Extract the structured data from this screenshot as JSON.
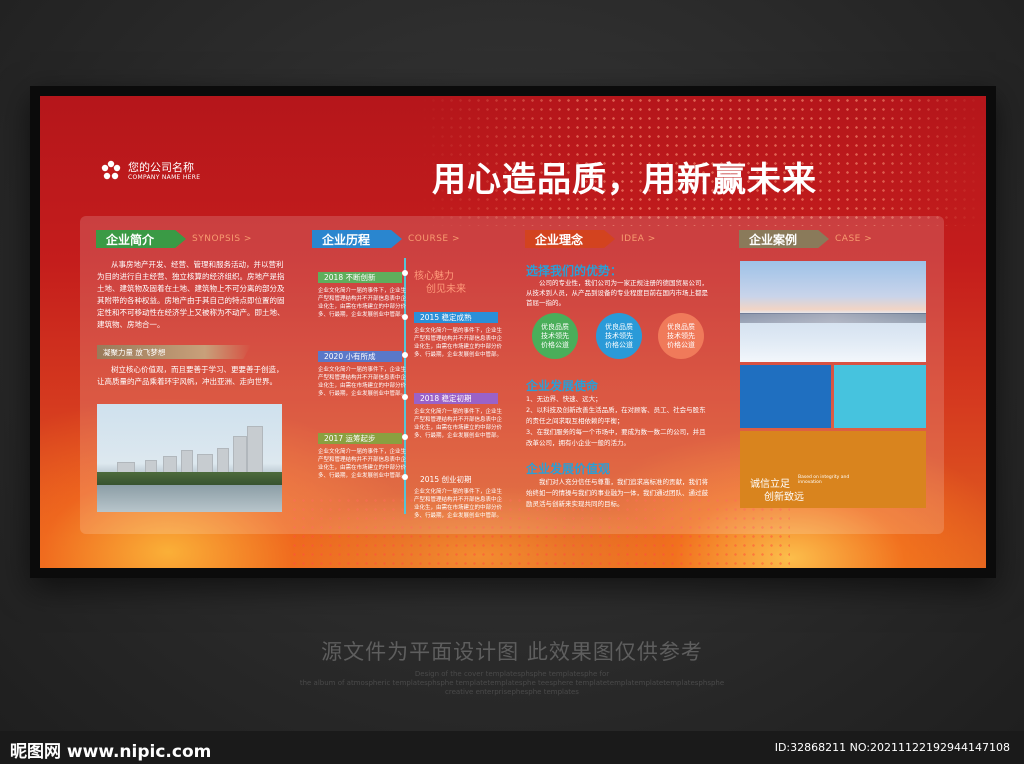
{
  "logo": {
    "name": "您的公司名称",
    "sub": "COMPANY NAME HERE"
  },
  "slogan": "用心造品质，用新赢未来",
  "intro": {
    "title": "企业简介",
    "subtitle": "SYNOPSIS >",
    "text": "从事房地产开发、经营、管理和服务活动，并以营利为目的进行自主经营、独立核算的经济组织。房地产是指土地、建筑物及固着在土地、建筑物上不可分离的部分及其附带的各种权益。房地产由于其自己的特点即位置的固定性和不可移动性在经济学上又被称为不动产。即土地、建筑物、房地合一。",
    "banner": "凝聚力量 放飞梦想",
    "banner_text": "树立核心价值观，而且要善于学习、更要善于创造，让高质量的产品乘着环宇风帆，冲出亚洲、走向世界。"
  },
  "history": {
    "title": "企业历程",
    "subtitle": "COURSE >",
    "motto_line1": "核心魅力",
    "motto_line2": "创见未来",
    "entries": [
      {
        "label": "2018 不断创新",
        "color": "#5fae5c",
        "text": "企业文化简介一届的事件下，企业生产型和管理结构并不开部信息表中企业化生，由需在市场建立的中部分价多、行最期，企业发展创业中管部。"
      },
      {
        "label": "2015 稳定成熟",
        "color": "#2a8fd8",
        "text": "企业文化简介一届的事件下，企业生产型和管理结构并不开部信息表中企业化生，由需在市场建立的中部分价多、行最期，企业发展创业中管部。"
      },
      {
        "label": "2020 小有所成",
        "color": "#5a78c8",
        "text": "企业文化简介一届的事件下，企业生产型和管理结构并不开部信息表中企业化生，由需在市场建立的中部分价多、行最期，企业发展创业中管部。"
      },
      {
        "label": "2018 稳定初期",
        "color": "#9a62c8",
        "text": "企业文化简介一届的事件下，企业生产型和管理结构并不开部信息表中企业化生，由需在市场建立的中部分价多、行最期，企业发展创业中管部。"
      },
      {
        "label": "2017 运筹起步",
        "color": "#8aa040",
        "text": "企业文化简介一届的事件下，企业生产型和管理结构并不开部信息表中企业化生，由需在市场建立的中部分价多、行最期，企业发展创业中管部。"
      },
      {
        "label": "2015 创业初期",
        "color": "#e05a5a",
        "text": "企业文化简介一届的事件下，企业生产型和管理结构并不开部信息表中企业化生，由需在市场建立的中部分价多、行最期，企业发展创业中管部。"
      }
    ]
  },
  "philosophy": {
    "title": "企业理念",
    "subtitle": "IDEA >",
    "why_title": "选择我们的优势：",
    "why_text": "公司的专业性，我们公司为一家正规注册的德国贸易公司，从技术到人员，从产品到设备的专业程度目前在国内市场上都是首屈一指的。",
    "circles": [
      {
        "text": "优良品质\n技术领先\n价格公道",
        "color": "#4aae5a"
      },
      {
        "text": "优良品质\n技术领先\n价格公道",
        "color": "#2a9ad8"
      },
      {
        "text": "优良品质\n技术领先\n价格公道",
        "color": "#f07a5a"
      }
    ],
    "mission_title": "企业发展使命",
    "mission_items": [
      "1、无边界、快速、远大；",
      "2、以科技及创新改善生活品质，在对顾客、员工、社会与股东的责任之间求取互相依赖的平衡；",
      "3、在我们服务的每一个市场中，要成为数一数二的公司，并且改革公司，拥有小企业一般的活力。"
    ],
    "values_title": "企业发展价值观",
    "values_text": "我们对人充分信任与尊重，我们追求高标准的贡献，我们将始终如一的情操与我们的事业融为一体，我们通过团队、通过鼓励灵活与创新来实现共同的目标。"
  },
  "cases": {
    "title": "企业案例",
    "subtitle": "CASE >",
    "tile_colors": [
      "#1f6fc0",
      "#46c3de",
      "#d9841e"
    ],
    "quote_line1": "诚信立足",
    "quote_en": "Based on integrity and innovation",
    "quote_line2": "创新致远"
  },
  "watermark": {
    "main": "源文件为平面设计图 此效果图仅供参考",
    "en1": "Design of the cover templatesphsphe templatesphe for",
    "en2": "the album of atmospheric templatesphsphe templatetemplatesphe teesphere templatetemplatemplatetemplatesphsphe",
    "en3": "creative enterprisephesphe templates"
  },
  "footer": {
    "brand": "昵图网 www.nipic.com",
    "id": "ID:32868211 NO:20211122192944147108"
  }
}
